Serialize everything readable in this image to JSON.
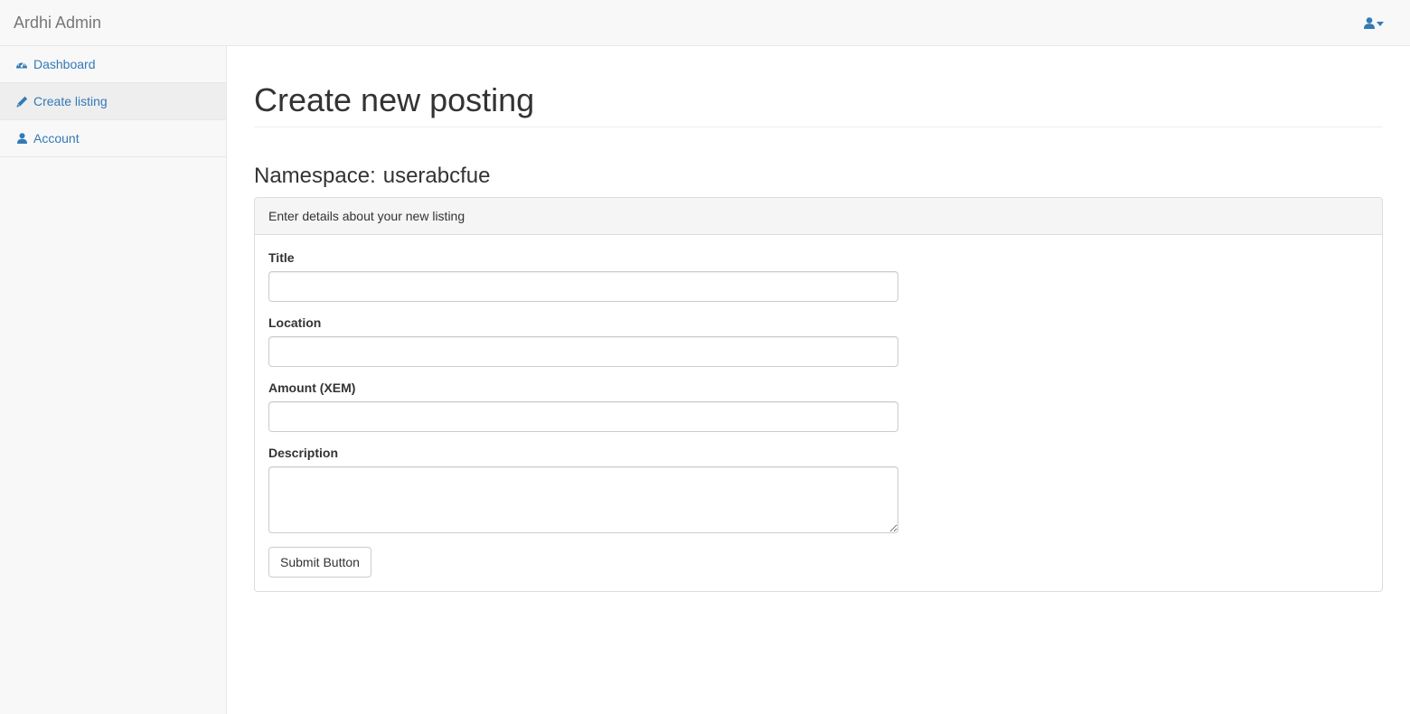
{
  "app": {
    "brand": "Ardhi Admin"
  },
  "header": {
    "user_icon": "user-icon",
    "dropdown_icon": "caret-down-icon"
  },
  "colors": {
    "link": "#337ab7",
    "navbar_bg": "#f8f8f8",
    "active_item_bg": "#eeeeee"
  },
  "sidebar": {
    "items": [
      {
        "label": "Dashboard",
        "icon": "dashboard-icon",
        "active": false
      },
      {
        "label": "Create listing",
        "icon": "pencil-icon",
        "active": true
      },
      {
        "label": "Account",
        "icon": "user-icon",
        "active": false
      }
    ]
  },
  "main": {
    "page_title": "Create new posting",
    "namespace_label": "Namespace:",
    "namespace_value": "userabcfue",
    "panel": {
      "heading": "Enter details about your new listing",
      "fields": {
        "title": {
          "label": "Title",
          "value": "",
          "placeholder": ""
        },
        "location": {
          "label": "Location",
          "value": "",
          "placeholder": ""
        },
        "amount": {
          "label": "Amount (XEM)",
          "value": "",
          "placeholder": ""
        },
        "description": {
          "label": "Description",
          "value": "",
          "placeholder": ""
        }
      },
      "submit_label": "Submit Button"
    }
  }
}
